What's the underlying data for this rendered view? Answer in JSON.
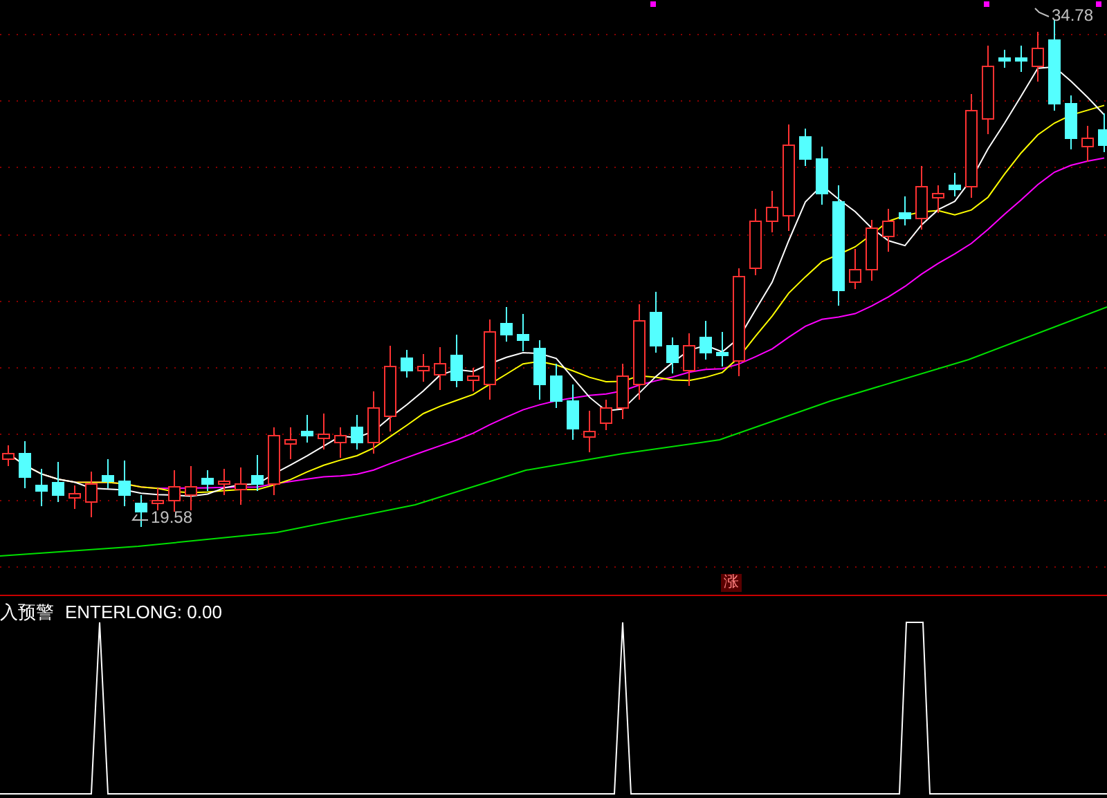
{
  "price_chart": {
    "low_label": "19.58",
    "high_label": "34.78",
    "marker": "涨"
  },
  "indicator": {
    "name": "入预警",
    "reading": "ENTERLONG: 0.00"
  }
}
